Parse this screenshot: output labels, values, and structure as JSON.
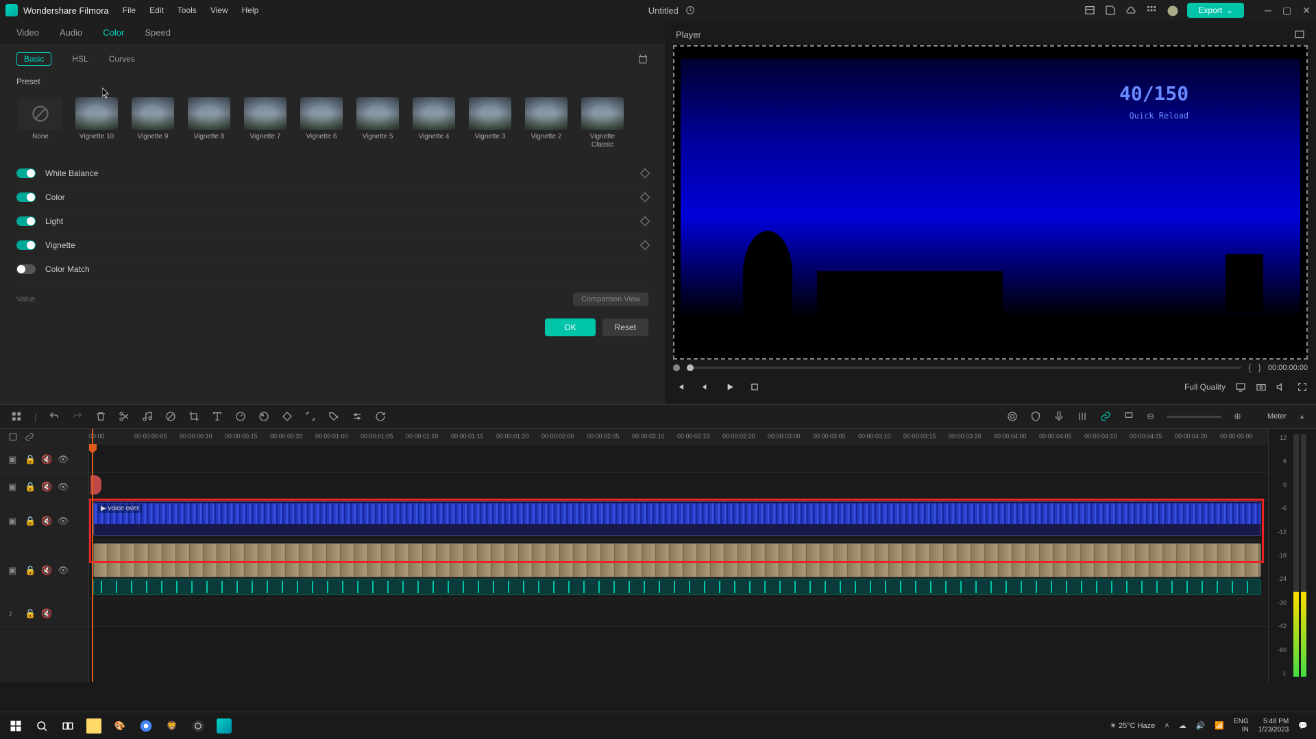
{
  "app": {
    "name": "Wondershare Filmora",
    "doc_title": "Untitled"
  },
  "menu": {
    "items": [
      "File",
      "Edit",
      "Tools",
      "View",
      "Help"
    ]
  },
  "export": {
    "label": "Export"
  },
  "cat_tabs": {
    "items": [
      "Video",
      "Audio",
      "Color",
      "Speed"
    ],
    "active": "Color"
  },
  "sub_tabs": {
    "items": [
      "Basic",
      "HSL",
      "Curves"
    ],
    "active": "Basic"
  },
  "preset": {
    "label": "Preset",
    "items": [
      {
        "name": "None"
      },
      {
        "name": "Vignette 10"
      },
      {
        "name": "Vignette 9"
      },
      {
        "name": "Vignette 8"
      },
      {
        "name": "Vignette 7"
      },
      {
        "name": "Vignette 6"
      },
      {
        "name": "Vignette 5"
      },
      {
        "name": "Vignette 4"
      },
      {
        "name": "Vignette 3"
      },
      {
        "name": "Vignette 2"
      },
      {
        "name": "Vignette Classic"
      }
    ]
  },
  "sections": {
    "white_balance": "White Balance",
    "color": "Color",
    "light": "Light",
    "vignette": "Vignette",
    "color_match": "Color Match"
  },
  "value_label": "Value",
  "comparison": "Comparison View",
  "buttons": {
    "ok": "OK",
    "reset": "Reset"
  },
  "player": {
    "title": "Player",
    "timecode": "00:00:00:00",
    "quality": "Full Quality",
    "hud_big": "40/150",
    "hud_small": "Quick Reload"
  },
  "timeline": {
    "ruler_ticks": [
      "00:00",
      "00:00:00:05",
      "00:00:00:10",
      "00:00:00:15",
      "00:00:00:20",
      "00:00:01:00",
      "00:00:01:05",
      "00:00:01:10",
      "00:00:01:15",
      "00:00:01:20",
      "00:00:02:00",
      "00:00:02:05",
      "00:00:02:10",
      "00:00:02:15",
      "00:00:02:20",
      "00:00:03:00",
      "00:00:03:05",
      "00:00:03:10",
      "00:00:03:15",
      "00:00:03:20",
      "00:00:04:00",
      "00:00:04:05",
      "00:00:04:10",
      "00:00:04:15",
      "00:00:04:20",
      "00:00:05:00"
    ],
    "clip_voice_label": "voice over",
    "meter_label": "Meter",
    "db_ticks": [
      "12",
      "6",
      "0",
      "-6",
      "-12",
      "-18",
      "-24",
      "-30",
      "-42",
      "-60",
      "L"
    ]
  },
  "taskbar": {
    "weather": "25°C  Haze",
    "lang1": "ENG",
    "lang2": "IN",
    "time": "5:48 PM",
    "date": "1/23/2023"
  }
}
